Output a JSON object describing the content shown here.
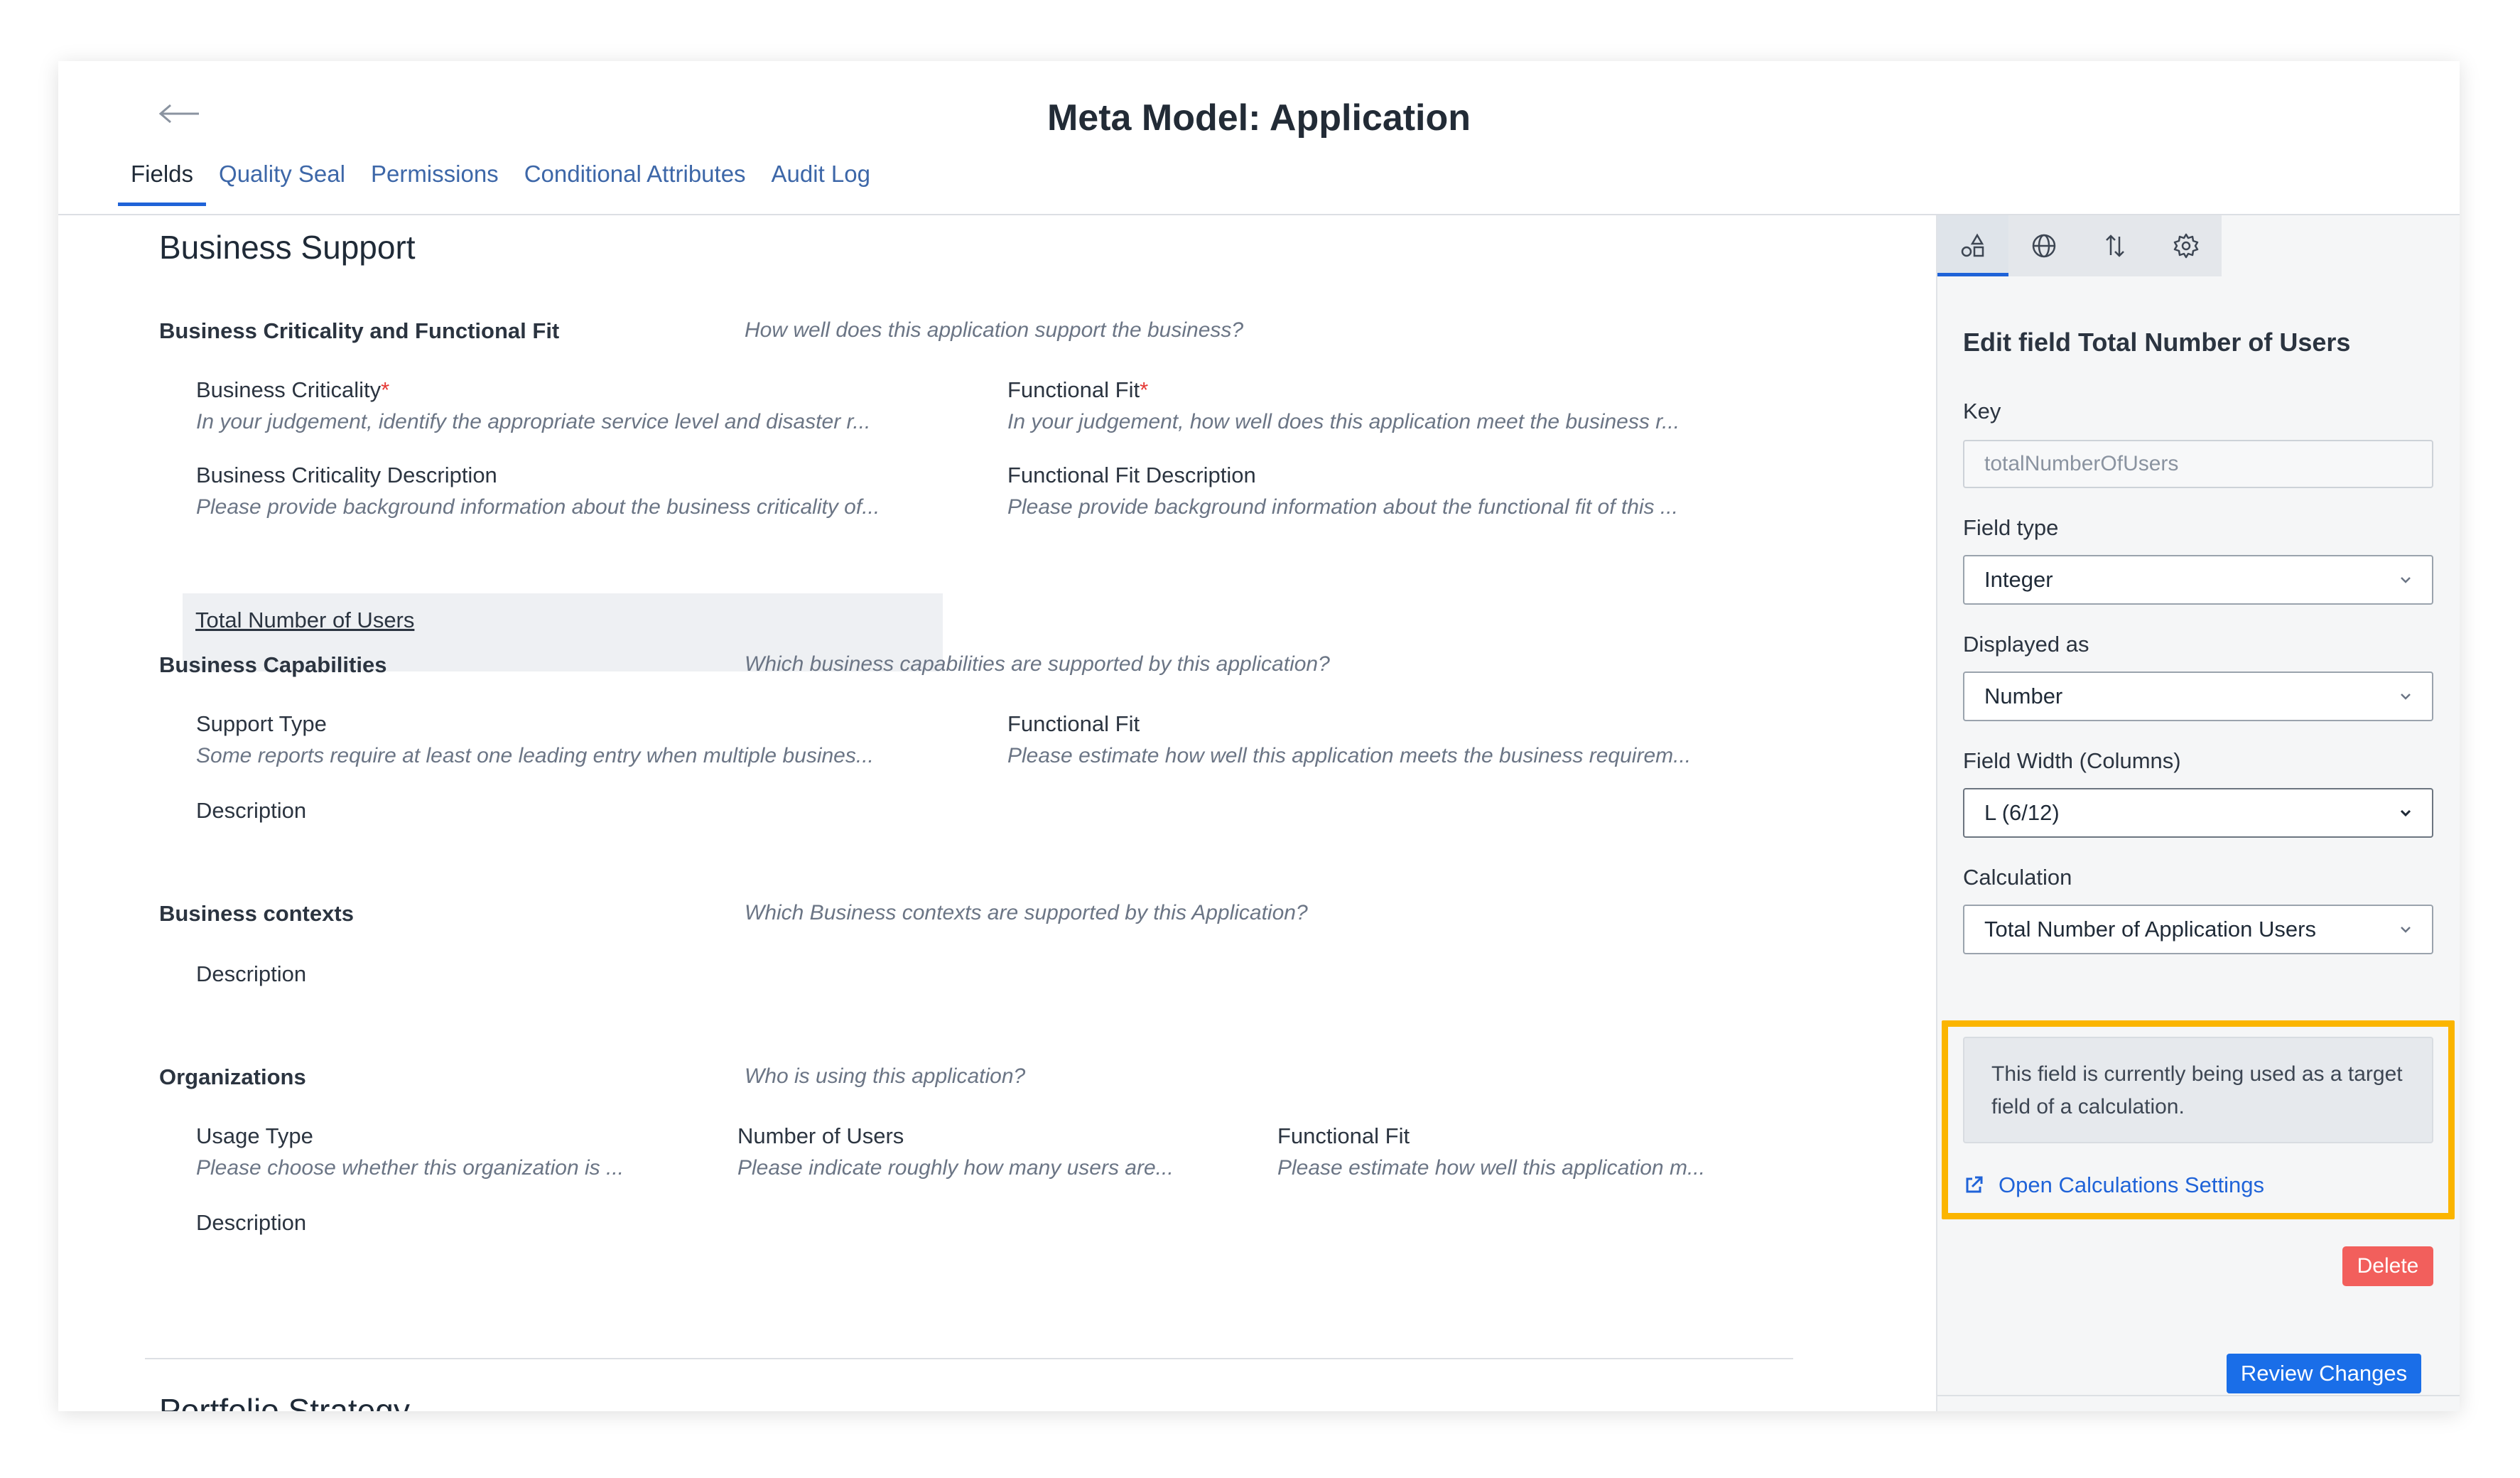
{
  "header": {
    "title": "Meta Model: Application",
    "tabs": [
      {
        "label": "Fields"
      },
      {
        "label": "Quality Seal"
      },
      {
        "label": "Permissions"
      },
      {
        "label": "Conditional Attributes"
      },
      {
        "label": "Audit Log"
      }
    ]
  },
  "main": {
    "section_title": "Business Support",
    "groups": {
      "criticality": {
        "title": "Business Criticality and Functional Fit",
        "hint": "How well does this application support the business?",
        "fields": [
          {
            "label": "Business Criticality",
            "required": "*",
            "desc": "In your judgement, identify the appropriate service level and disaster r..."
          },
          {
            "label": "Functional Fit",
            "required": "*",
            "desc": "In your judgement, how well does this application meet the business r..."
          },
          {
            "label": "Business Criticality Description",
            "desc": "Please provide background information about the business criticality of..."
          },
          {
            "label": "Functional Fit Description",
            "desc": "Please provide background information about the functional fit of this ..."
          },
          {
            "label": "Total Number of Users"
          }
        ]
      },
      "capabilities": {
        "title": "Business Capabilities",
        "hint": "Which business capabilities are supported by this application?",
        "fields": [
          {
            "label": "Support Type",
            "desc": "Some reports require at least one leading entry when multiple busines..."
          },
          {
            "label": "Functional Fit",
            "desc": "Please estimate how well this application meets the business requirem..."
          },
          {
            "label": "Description"
          }
        ]
      },
      "contexts": {
        "title": "Business contexts",
        "hint": "Which Business contexts are supported by this Application?",
        "fields": [
          {
            "label": "Description"
          }
        ]
      },
      "organizations": {
        "title": "Organizations",
        "hint": "Who is using this application?",
        "fields": [
          {
            "label": "Usage Type",
            "desc": "Please choose whether this organization is ..."
          },
          {
            "label": "Number of Users",
            "desc": "Please indicate roughly how many users are..."
          },
          {
            "label": "Functional Fit",
            "desc": "Please estimate how well this application m..."
          },
          {
            "label": "Description"
          }
        ]
      }
    },
    "next_section_title": "Portfolio Strategy"
  },
  "panel": {
    "tab_icons": [
      "shapes-icon",
      "globe-icon",
      "sort-icon",
      "gear-icon"
    ],
    "title": "Edit field Total Number of Users",
    "key": {
      "label": "Key",
      "placeholder": "totalNumberOfUsers"
    },
    "field_type": {
      "label": "Field type",
      "value": "Integer"
    },
    "displayed_as": {
      "label": "Displayed as",
      "value": "Number"
    },
    "field_width": {
      "label": "Field Width (Columns)",
      "value": "L (6/12)"
    },
    "calculation": {
      "label": "Calculation",
      "value": "Total Number of Application Users"
    },
    "notice": "This field is currently being used as a target field of a calculation.",
    "calc_link": "Open Calculations Settings",
    "delete_label": "Delete",
    "review_label": "Review Changes"
  },
  "colors": {
    "accent": "#1f63d8",
    "highlight": "#fbb500",
    "danger": "#f25f5c",
    "required": "#e53935"
  }
}
